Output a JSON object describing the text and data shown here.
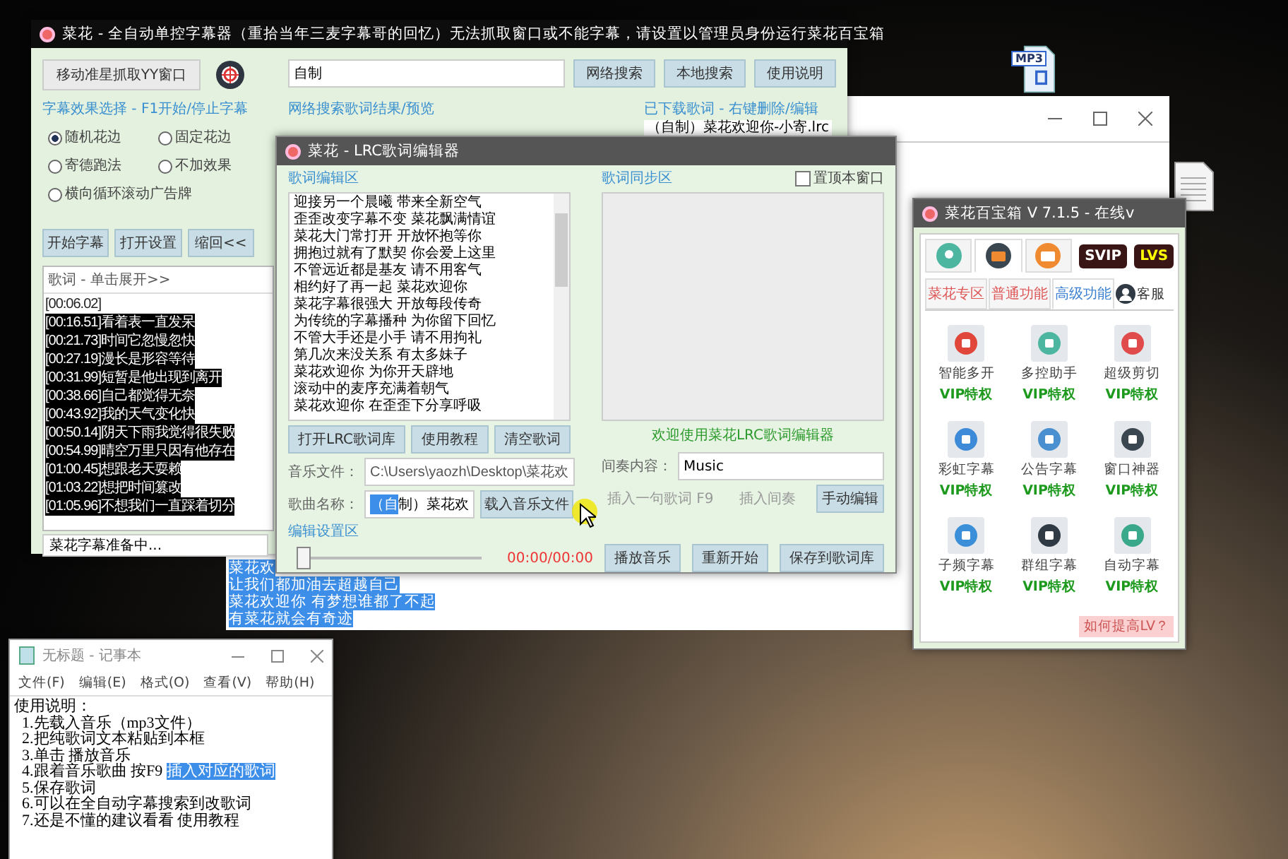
{
  "desktop": {
    "files": [
      {
        "kind": "mp3",
        "label": "MP3"
      },
      {
        "kind": "document"
      }
    ]
  },
  "back_window": {
    "selected_lines": [
      "菜花欢",
      "让我们都加油去超越自己",
      "菜花欢迎你 有梦想谁都了不起",
      "有菜花就会有奇迹"
    ]
  },
  "main_window": {
    "title": "菜花 - 全自动单控字幕器（重拾当年三麦字幕哥的回忆）无法抓取窗口或不能字幕，请设置以管理员身份运行菜花百宝箱",
    "grab_button": "移动准星抓取YY窗口",
    "search_value": "自制",
    "search_buttons": [
      "网络搜索",
      "本地搜索",
      "使用说明"
    ],
    "effects": {
      "legend": "字幕效果选择 - F1开始/停止字幕",
      "options": [
        {
          "label": "随机花边",
          "selected": true
        },
        {
          "label": "固定花边",
          "selected": false
        },
        {
          "label": "寄德跑法",
          "selected": false
        },
        {
          "label": "不加效果",
          "selected": false
        },
        {
          "label": "横向循环滚动广告牌",
          "selected": false
        }
      ]
    },
    "actions": [
      "开始字幕",
      "打开设置",
      "缩回<<"
    ],
    "lyrics": {
      "header": "歌词 - 单击展开>>",
      "items": [
        {
          "text": "[00:06.02]",
          "selected": false
        },
        {
          "text": "[00:16.51]看着表一直发呆",
          "selected": true
        },
        {
          "text": "[00:21.73]时间它忽慢忽快",
          "selected": true
        },
        {
          "text": "[00:27.19]漫长是形容等待",
          "selected": true
        },
        {
          "text": "[00:31.99]短暂是他出现到离开",
          "selected": true
        },
        {
          "text": "[00:38.66]自己都觉得无奈",
          "selected": true
        },
        {
          "text": "[00:43.92]我的天气变化快",
          "selected": true
        },
        {
          "text": "[00:50.14]阴天下雨我觉得很失败",
          "selected": true
        },
        {
          "text": "[00:54.99]晴空万里只因有他存在",
          "selected": true
        },
        {
          "text": "[01:00.45]想跟老天耍赖",
          "selected": true
        },
        {
          "text": "[01:03.22]想把时间篡改",
          "selected": true
        },
        {
          "text": "[01:05.96]不想我们一直踩着切分",
          "selected": true
        }
      ]
    },
    "results_legend": "网络搜索歌词结果/预览",
    "downloads": {
      "legend": "已下载歌词 - 右键删除/编辑",
      "items": [
        "（自制）菜花欢迎你-小寄.lrc"
      ]
    },
    "status": "菜花字幕准备中..."
  },
  "editor": {
    "title": "菜花 - LRC歌词编辑器",
    "edit_legend": "歌词编辑区",
    "lines": [
      "迎接另一个晨曦 带来全新空气",
      "歪歪改变字幕不变 菜花飘满情谊",
      "菜花大门常打开 开放怀抱等你",
      "拥抱过就有了默契 你会爱上这里",
      "不管远近都是基友 请不用客气",
      "相约好了再一起 菜花欢迎你",
      "菜花字幕很强大 开放每段传奇",
      "为传统的字幕播种 为你留下回忆",
      "不管大手还是小手 请不用拘礼",
      "第几次来没关系 有太多妹子",
      "菜花欢迎你 为你开天辟地",
      "滚动中的麦序充满着朝气",
      "菜花欢迎你 在歪歪下分享呼吸"
    ],
    "sync_legend": "歌词同步区",
    "pin_window": {
      "label": "置顶本窗口",
      "checked": false
    },
    "left_buttons": [
      "打开LRC歌词库",
      "使用教程",
      "清空歌词"
    ],
    "welcome": "欢迎使用菜花LRC歌词编辑器",
    "music_file": {
      "label": "音乐文件：",
      "value": "C:\\Users\\yaozh\\Desktop\\菜花欢"
    },
    "song_name": {
      "label": "歌曲名称：",
      "selected_part": "（自",
      "value": "制）菜花欢"
    },
    "load_button": "载入音乐文件",
    "interlude": {
      "label": "间奏内容：",
      "value": "Music"
    },
    "sync_buttons": [
      {
        "label": "插入一句歌词 F9",
        "disabled": true
      },
      {
        "label": "插入间奏",
        "disabled": true
      },
      {
        "label": "手动编辑",
        "disabled": false
      }
    ],
    "settings_legend": "编辑设置区",
    "progress": {
      "level": 0
    },
    "time": "00:00/00:00",
    "bottom_buttons": [
      "播放音乐",
      "重新开始",
      "保存到歌词库"
    ]
  },
  "toolbox": {
    "title": "菜花百宝箱 V 7.1.5 - 在线v",
    "icon_tabs": [
      {
        "kind": "pin",
        "selected": false
      },
      {
        "kind": "briefcase",
        "selected": true
      },
      {
        "kind": "folder",
        "selected": false
      }
    ],
    "badges": [
      "SVIP",
      "LVS"
    ],
    "tabs": [
      {
        "label": "菜花专区",
        "selected": false
      },
      {
        "label": "普通功能",
        "selected": false
      },
      {
        "label": "高级功能",
        "selected": true
      }
    ],
    "service": "客服",
    "tools": [
      {
        "name": "智能多开",
        "tag": "VIP特权",
        "color": "#e0463a"
      },
      {
        "name": "多控助手",
        "tag": "VIP特权",
        "color": "#4db6a0"
      },
      {
        "name": "超级剪切",
        "tag": "VIP特权",
        "color": "#e04b4b"
      },
      {
        "name": "彩虹字幕",
        "tag": "VIP特权",
        "color": "#3c8ad8"
      },
      {
        "name": "公告字幕",
        "tag": "VIP特权",
        "color": "#4a90d0"
      },
      {
        "name": "窗口神器",
        "tag": "VIP特权",
        "color": "#3a4650"
      },
      {
        "name": "子频字幕",
        "tag": "VIP特权",
        "color": "#3a8fd8"
      },
      {
        "name": "群组字幕",
        "tag": "VIP特权",
        "color": "#2f3a44"
      },
      {
        "name": "自动字幕",
        "tag": "VIP特权",
        "color": "#3aa88a"
      }
    ],
    "help_link": "如何提高LV？"
  },
  "notepad": {
    "title": "无标题 - 记事本",
    "menu": [
      "文件(F)",
      "编辑(E)",
      "格式(O)",
      "查看(V)",
      "帮助(H)"
    ],
    "lines": [
      {
        "text": "使用说明："
      },
      {
        "text": "  1.先载入音乐（mp3文件）"
      },
      {
        "text": "  2.把纯歌词文本粘贴到本框"
      },
      {
        "text": "  3.单击 播放音乐"
      },
      {
        "text": "  4.跟着音乐歌曲 按F9 ",
        "highlight": "插入对应的歌词"
      },
      {
        "text": "  5.保存歌词"
      },
      {
        "text": "  6.可以在全自动字幕搜索到改歌词"
      },
      {
        "text": "  7.还是不懂的建议看看 使用教程"
      }
    ]
  }
}
